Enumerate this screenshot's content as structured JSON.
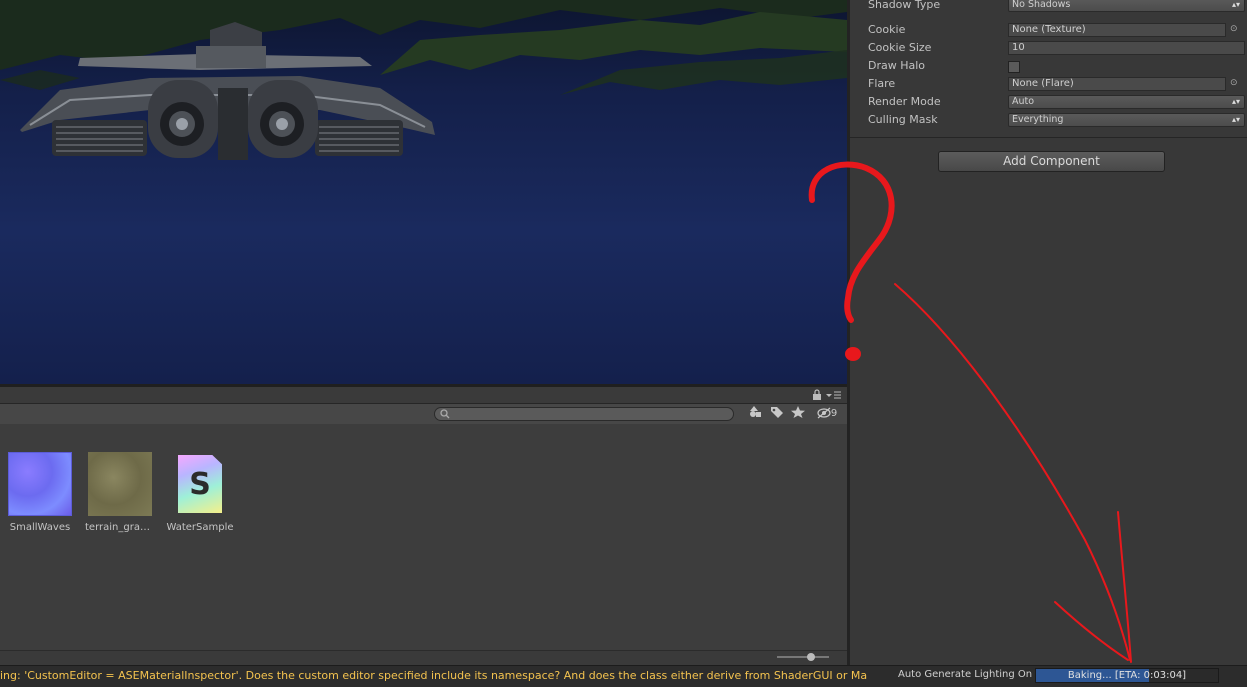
{
  "inspector": {
    "rows": [
      {
        "label": "Shadow Type",
        "value": "No Shadows",
        "kind": "dropdown"
      },
      {
        "label": "Cookie",
        "value": "None (Texture)",
        "kind": "object"
      },
      {
        "label": "Cookie Size",
        "value": "10",
        "kind": "number"
      },
      {
        "label": "Draw Halo",
        "value": "",
        "kind": "checkbox"
      },
      {
        "label": "Flare",
        "value": "None (Flare)",
        "kind": "object"
      },
      {
        "label": "Render Mode",
        "value": "Auto",
        "kind": "dropdown"
      },
      {
        "label": "Culling Mask",
        "value": "Everything",
        "kind": "dropdown"
      }
    ],
    "add_component_label": "Add Component"
  },
  "project": {
    "visible_count": "9",
    "assets": [
      {
        "name": "SmallWaves",
        "icon": "normal-map-texture-icon"
      },
      {
        "name": "terrain_gras…",
        "icon": "grass-texture-icon"
      },
      {
        "name": "WaterSample",
        "icon": "shader-file-icon"
      }
    ],
    "shader_glyph": "S"
  },
  "status": {
    "message": "ing: 'CustomEditor = ASEMaterialInspector'. Does the custom editor specified include its namespace? And does the class either derive from ShaderGUI or Ma",
    "auto_lighting": "Auto Generate Lighting On",
    "bake_text": "Baking... [ETA: 0:03:04]",
    "bake_progress": 0.62
  },
  "colors": {
    "warning_text": "#f4c34f",
    "progress_fill": "#2d5694",
    "annotation": "#e8181c"
  },
  "icons": [
    "lock-icon",
    "menu-icon",
    "search-icon",
    "filter-by-type-icon",
    "filter-by-label-icon",
    "favorite-icon",
    "hidden-packages-icon"
  ]
}
